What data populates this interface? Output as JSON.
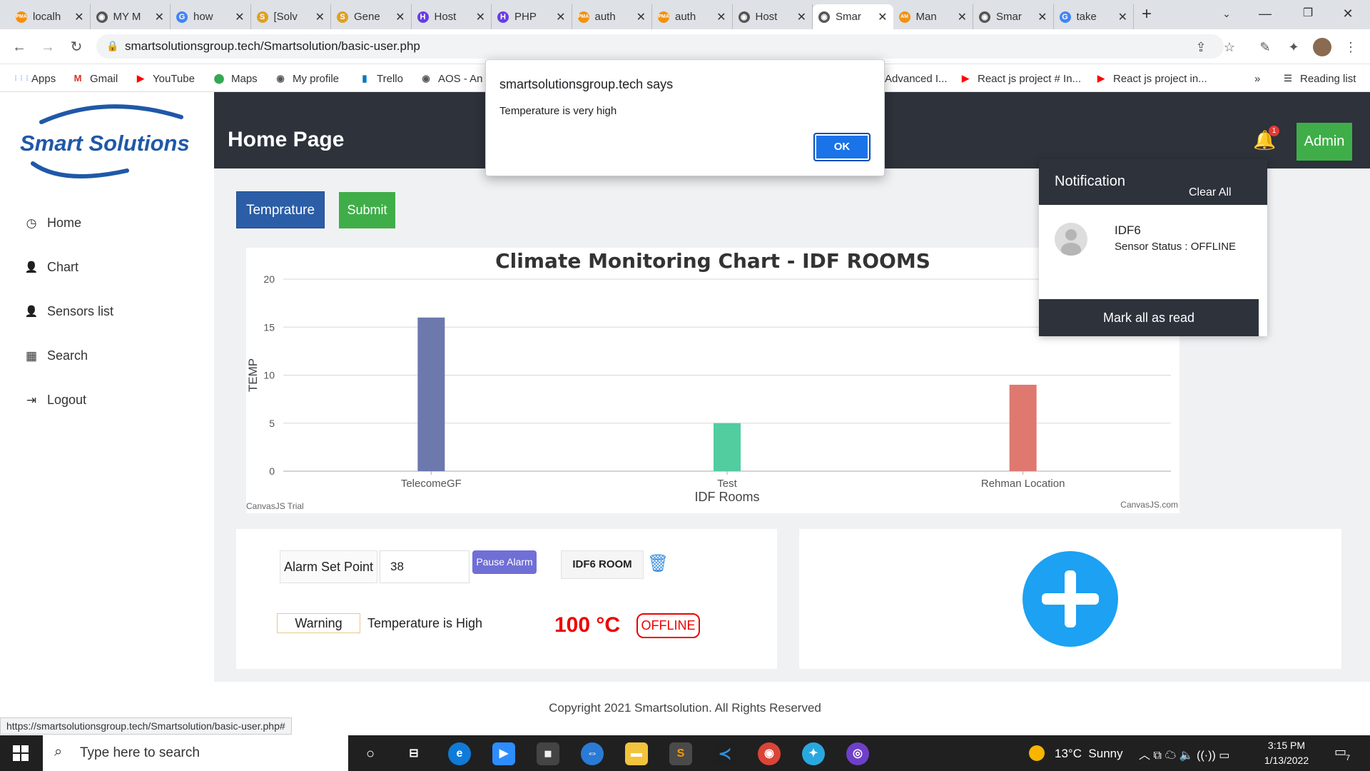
{
  "browser": {
    "tabs": [
      {
        "title": "localh",
        "fav": "PMA",
        "color": "#f29111"
      },
      {
        "title": "MY M",
        "fav": "◉",
        "color": "#555"
      },
      {
        "title": "how",
        "fav": "G",
        "color": "#4285f4"
      },
      {
        "title": "[Solv",
        "fav": "S",
        "color": "#e0a020"
      },
      {
        "title": "Gene",
        "fav": "S",
        "color": "#e0a020"
      },
      {
        "title": "Host",
        "fav": "H",
        "color": "#673de6"
      },
      {
        "title": "PHP",
        "fav": "H",
        "color": "#673de6"
      },
      {
        "title": "auth",
        "fav": "PMA",
        "color": "#f29111"
      },
      {
        "title": "auth",
        "fav": "PMA",
        "color": "#f29111"
      },
      {
        "title": "Host",
        "fav": "◉",
        "color": "#555"
      },
      {
        "title": "Smar",
        "fav": "◉",
        "color": "#555"
      },
      {
        "title": "Man",
        "fav": "AM",
        "color": "#f29111"
      },
      {
        "title": "Smar",
        "fav": "◉",
        "color": "#555"
      },
      {
        "title": "take",
        "fav": "G",
        "color": "#4285f4"
      }
    ],
    "new_tab": "+",
    "url": "smartsolutionsgroup.tech/Smartsolution/basic-user.php",
    "status_url": "https://smartsolutionsgroup.tech/Smartsolution/basic-user.php#",
    "bookmarks": [
      {
        "label": "Apps",
        "icon": "⋮⋮⋮",
        "color": "#4285f4"
      },
      {
        "label": "Gmail",
        "icon": "M",
        "color": "#d93025"
      },
      {
        "label": "YouTube",
        "icon": "▶",
        "color": "#ff0000"
      },
      {
        "label": "Maps",
        "icon": "⬤",
        "color": "#34a853"
      },
      {
        "label": "My profile",
        "icon": "◉",
        "color": "#555"
      },
      {
        "label": "Trello",
        "icon": "▮",
        "color": "#0079bf"
      },
      {
        "label": "AOS - An",
        "icon": "◉",
        "color": "#555"
      },
      {
        "label": "Advanced I...",
        "icon": "",
        "color": "#555"
      },
      {
        "label": "React js project # In...",
        "icon": "▶",
        "color": "#ff0000"
      },
      {
        "label": "React js project in...",
        "icon": "▶",
        "color": "#ff0000"
      }
    ],
    "more": "»",
    "reading_list": "Reading list"
  },
  "app": {
    "logo_text": "Smart Solutions",
    "page_title": "Home Page",
    "bell_count": "1",
    "admin_label": "Admin",
    "nav": [
      {
        "label": "Home",
        "icon": "clock-icon"
      },
      {
        "label": "Chart",
        "icon": "user-icon"
      },
      {
        "label": "Sensors list",
        "icon": "user-icon"
      },
      {
        "label": "Search",
        "icon": "table-icon"
      },
      {
        "label": "Logout",
        "icon": "logout-icon"
      }
    ],
    "temp_button": "Temprature",
    "submit_button": "Submit",
    "footer": "Copyright 2021 Smartsolution. All Rights Reserved"
  },
  "chart_data": {
    "type": "bar",
    "title": "Climate Monitoring Chart - IDF ROOMS",
    "xlabel": "IDF Rooms",
    "ylabel": "TEMP",
    "categories": [
      "TelecomeGF",
      "Test",
      "Rehman Location"
    ],
    "values": [
      16,
      5,
      9
    ],
    "colors": [
      "#6d78ad",
      "#51cda0",
      "#df7970"
    ],
    "ylim": [
      0,
      20
    ],
    "yticks": [
      0,
      5,
      10,
      15,
      20
    ],
    "grid": true,
    "credit_left": "CanvasJS Trial",
    "credit_right": "CanvasJS.com"
  },
  "alarm": {
    "setpoint_label": "Alarm Set Point",
    "setpoint_value": "38",
    "pause_button": "Pause Alarm",
    "room_label": "IDF6 ROOM",
    "warning_label": "Warning",
    "warning_text": "Temperature is High",
    "reading": "100 °C",
    "status": "OFFLINE"
  },
  "notification": {
    "title": "Notification",
    "clear_all": "Clear All",
    "item_name": "IDF6",
    "item_status": "Sensor Status : OFFLINE",
    "mark_read": "Mark all as read"
  },
  "dialog": {
    "title": "smartsolutionsgroup.tech says",
    "message": "Temperature is very high",
    "ok": "OK"
  },
  "taskbar": {
    "search_placeholder": "Type here to search",
    "weather": "13°C  Sunny",
    "time": "3:15 PM",
    "date": "1/13/2022",
    "notif_count": "7"
  }
}
